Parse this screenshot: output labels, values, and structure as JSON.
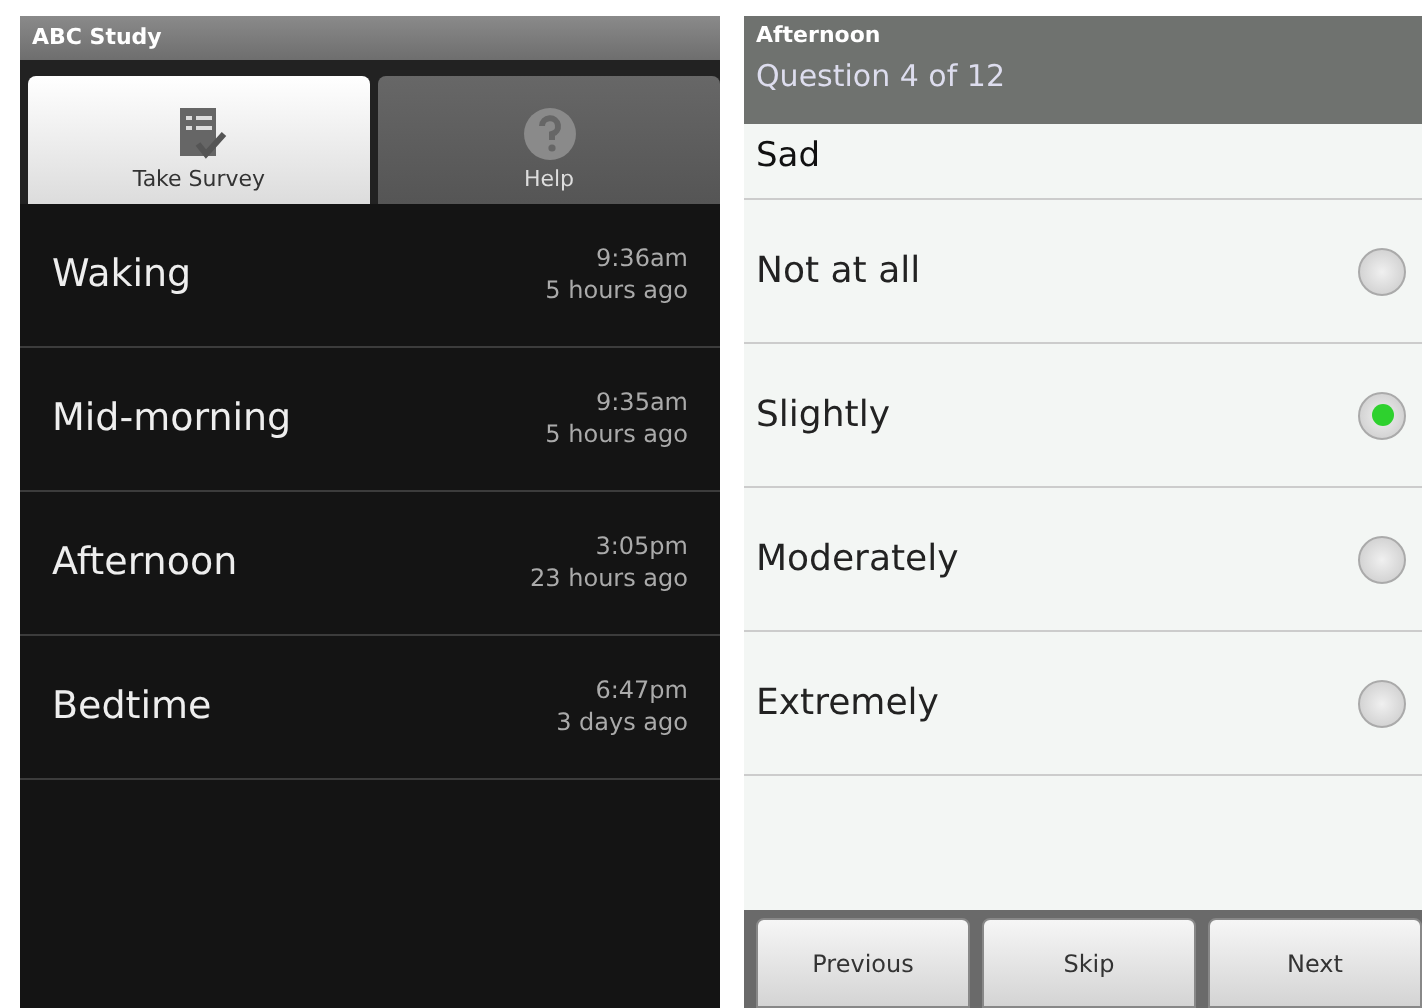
{
  "left_screen": {
    "title": "ABC Study",
    "tabs": [
      {
        "label": "Take Survey",
        "kind": "survey",
        "selected": true
      },
      {
        "label": "Help",
        "kind": "help",
        "selected": false
      }
    ],
    "surveys": [
      {
        "name": "Waking",
        "time": "9:36am",
        "ago": "5 hours ago"
      },
      {
        "name": "Mid-morning",
        "time": "9:35am",
        "ago": "5 hours ago"
      },
      {
        "name": "Afternoon",
        "time": "3:05pm",
        "ago": "23 hours ago"
      },
      {
        "name": "Bedtime",
        "time": "6:47pm",
        "ago": "3 days ago"
      }
    ]
  },
  "right_screen": {
    "survey": "Afternoon",
    "progress": "Question 4 of 12",
    "question": "Sad",
    "options": [
      {
        "label": "Not at all",
        "selected": false
      },
      {
        "label": "Slightly",
        "selected": true
      },
      {
        "label": "Moderately",
        "selected": false
      },
      {
        "label": "Extremely",
        "selected": false
      }
    ],
    "buttons": [
      "Previous",
      "Skip",
      "Next"
    ]
  }
}
